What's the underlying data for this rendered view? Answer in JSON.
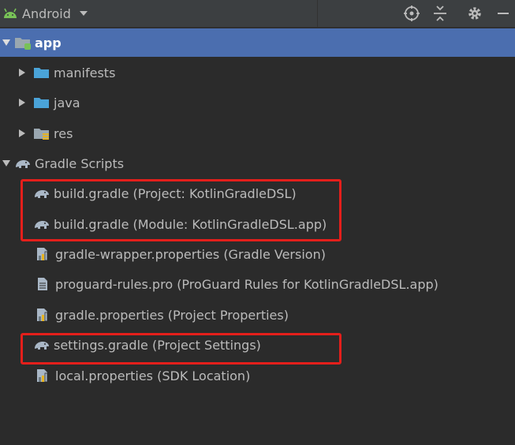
{
  "toolbar": {
    "view_label": "Android",
    "icons": [
      "locate-icon",
      "collapse-all-icon",
      "gear-icon",
      "minimize-icon"
    ]
  },
  "tree": {
    "app": "app",
    "manifests": "manifests",
    "java": "java",
    "res": "res",
    "gradle_scripts": "Gradle Scripts",
    "files": [
      "build.gradle (Project: KotlinGradleDSL)",
      "build.gradle (Module: KotlinGradleDSL.app)",
      "gradle-wrapper.properties (Gradle Version)",
      "proguard-rules.pro (ProGuard Rules for KotlinGradleDSL.app)",
      "gradle.properties (Project Properties)",
      "settings.gradle (Project Settings)",
      "local.properties (SDK Location)"
    ]
  },
  "colors": {
    "background": "#2b2b2b",
    "toolbar": "#3c3f41",
    "selection": "#4b6eaf",
    "highlight": "#e41f1b",
    "folder": "#4aa3d8",
    "android": "#78c257"
  }
}
